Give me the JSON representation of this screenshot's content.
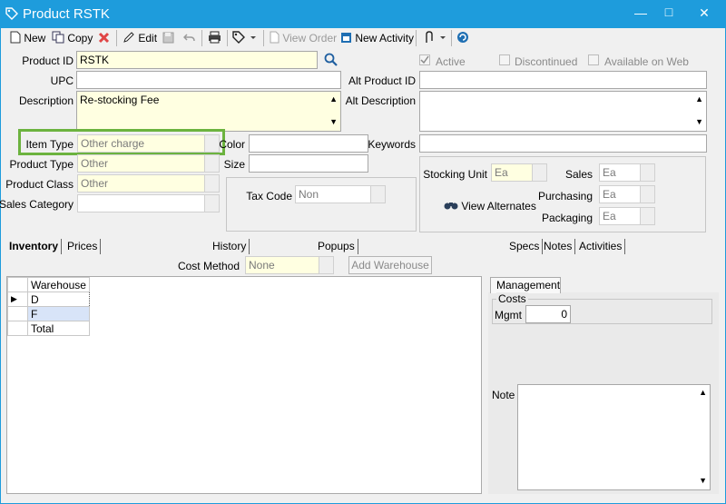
{
  "window": {
    "title": "Product RSTK",
    "controls": {
      "minimize": "—",
      "maximize": "□",
      "close": "✕"
    }
  },
  "toolbar": {
    "new": "New",
    "copy": "Copy",
    "edit": "Edit",
    "view_order": "View Order",
    "new_activity": "New Activity"
  },
  "form": {
    "product_id_label": "Product ID",
    "product_id": "RSTK",
    "upc_label": "UPC",
    "upc": "",
    "description_label": "Description",
    "description": "Re-stocking Fee",
    "item_type_label": "Item Type",
    "item_type": "Other charge",
    "product_type_label": "Product Type",
    "product_type": "Other",
    "product_class_label": "Product Class",
    "product_class": "Other",
    "sales_category_label": "Sales Category",
    "sales_category": "",
    "color_label": "Color",
    "color": "",
    "size_label": "Size",
    "size": "",
    "tax_code_label": "Tax Code",
    "tax_code": "Non",
    "alt_product_id_label": "Alt Product ID",
    "alt_product_id": "",
    "alt_description_label": "Alt Description",
    "alt_description": "",
    "keywords_label": "Keywords",
    "keywords": "",
    "active_label": "Active",
    "active_checked": true,
    "discontinued_label": "Discontinued",
    "available_on_web_label": "Available on Web"
  },
  "units": {
    "stocking_unit_label": "Stocking Unit",
    "stocking_unit": "Ea",
    "sales_label": "Sales",
    "sales": "Ea",
    "purchasing_label": "Purchasing",
    "purchasing": "Ea",
    "packaging_label": "Packaging",
    "packaging": "Ea",
    "view_alternates": "View Alternates"
  },
  "tabs": [
    "Inventory",
    "Prices",
    "History",
    "Popups",
    "Specs",
    "Notes",
    "Activities"
  ],
  "inventory": {
    "cost_method_label": "Cost Method",
    "cost_method": "None",
    "add_warehouse": "Add Warehouse",
    "grid_header": "Warehouse",
    "rows": [
      "D",
      "F",
      "Total"
    ]
  },
  "management": {
    "tab": "Management",
    "costs_label": "Costs",
    "mgmt_label": "Mgmt",
    "mgmt_value": "0",
    "note_label": "Note",
    "note": ""
  },
  "colors": {
    "title_bar": "#1e9cdc",
    "highlight": "#6cb33f",
    "required_field": "#ffffe1"
  }
}
